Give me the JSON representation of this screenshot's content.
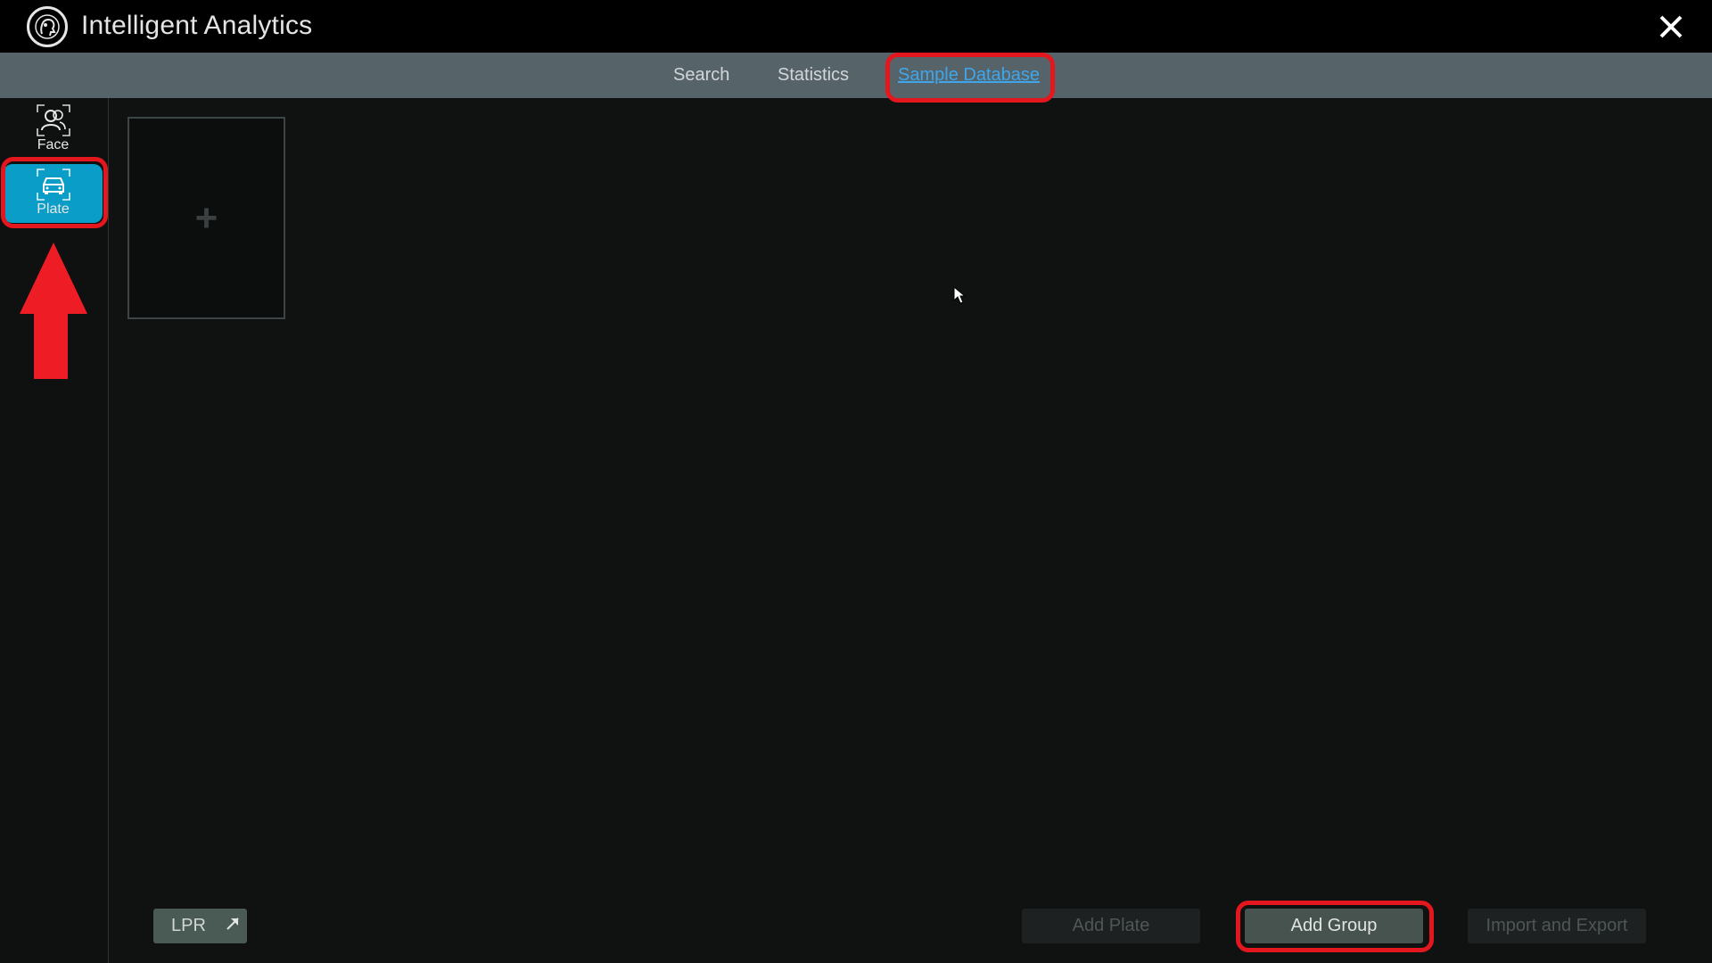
{
  "window": {
    "title": "Intelligent Analytics",
    "close_icon": "close-icon"
  },
  "tabs": [
    {
      "label": "Search"
    },
    {
      "label": "Statistics"
    },
    {
      "label": "Sample Database",
      "active": true
    }
  ],
  "sidebar": {
    "items": [
      {
        "label": "Face",
        "icon": "face-icon"
      },
      {
        "label": "Plate",
        "icon": "car-plate-icon",
        "selected": true
      }
    ]
  },
  "content": {
    "add_card_symbol": "+"
  },
  "footer": {
    "lpr_label": "LPR",
    "add_plate_label": "Add Plate",
    "add_group_label": "Add Group",
    "import_export_label": "Import and Export"
  },
  "colors": {
    "accent": "#0a9dc7",
    "active_tab": "#3fa6ec",
    "annotation": "#e3171d",
    "tabbar": "#56646a"
  }
}
